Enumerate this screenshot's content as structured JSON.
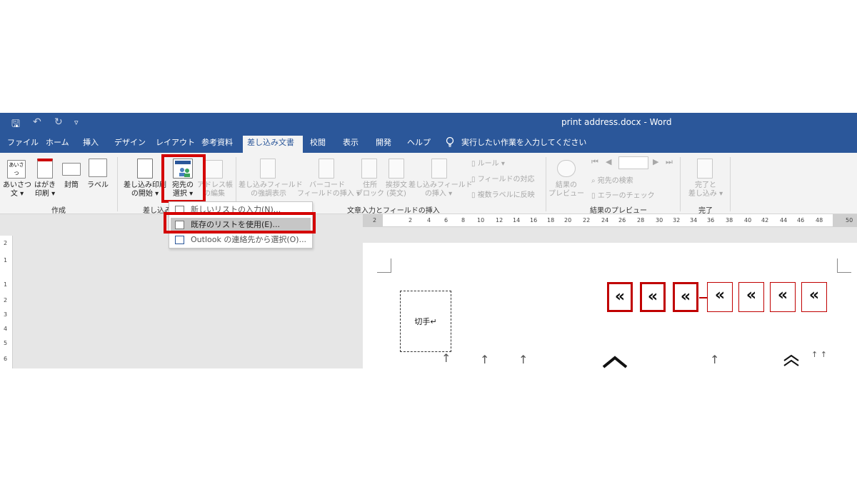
{
  "titlebar": {
    "title": "print address.docx  -  Word",
    "qa_save": "🖫",
    "qa_undo": "↶",
    "qa_redo": "↻",
    "qa_more": "▿"
  },
  "tabs": [
    {
      "label": "ファイル"
    },
    {
      "label": "ホーム"
    },
    {
      "label": "挿入"
    },
    {
      "label": "デザイン"
    },
    {
      "label": "レイアウト"
    },
    {
      "label": "参考資料"
    },
    {
      "label": "差し込み文書"
    },
    {
      "label": "校閲"
    },
    {
      "label": "表示"
    },
    {
      "label": "開発"
    },
    {
      "label": "ヘルプ"
    }
  ],
  "tellme": "実行したい作業を入力してください",
  "ribbon": {
    "create": {
      "group": "作成",
      "greeting": {
        "l1": "あいさつ",
        "l2": "文 ▾",
        "icon_text": "あいさつ"
      },
      "postcard": {
        "l1": "はがき",
        "l2": "印刷 ▾"
      },
      "envelope": {
        "l1": "封筒"
      },
      "label": {
        "l1": "ラベル"
      }
    },
    "start": {
      "group": "差し込み",
      "start_merge": {
        "l1": "差し込み印刷",
        "l2": "の開始 ▾"
      },
      "select_recipients": {
        "l1": "宛先の",
        "l2": "選択 ▾"
      },
      "edit_list": {
        "l1": "アドレス帳",
        "l2": "の編集"
      }
    },
    "fields": {
      "group": "文章入力とフィールドの挿入",
      "highlight": {
        "l1": "差し込みフィールド",
        "l2": "の強調表示"
      },
      "barcode": {
        "l1": "バーコード",
        "l2": "フィールドの挿入 ▾"
      },
      "address_block": {
        "l1": "住所",
        "l2": "ブロック"
      },
      "greeting_line": {
        "l1": "挨拶文",
        "l2": "(英文)"
      },
      "insert_field": {
        "l1": "差し込みフィールド",
        "l2": "の挿入 ▾"
      },
      "rules": "ルール ▾",
      "match_fields": "フィールドの対応",
      "update_labels": "複数ラベルに反映"
    },
    "preview": {
      "group": "結果のプレビュー",
      "preview_results": {
        "l1": "結果の",
        "l2": "プレビュー"
      },
      "find_recipient": "宛先の検索",
      "check_errors": "エラーのチェック"
    },
    "finish": {
      "group": "完了",
      "finish_merge": {
        "l1": "完了と",
        "l2": "差し込み ▾"
      }
    }
  },
  "dropdown": {
    "items": [
      {
        "label": "新しいリストの入力(N)..."
      },
      {
        "label": "既存のリストを使用(E)..."
      },
      {
        "label": "Outlook の連絡先から選択(O)..."
      }
    ]
  },
  "ruler": {
    "ticks": [
      "2",
      "2",
      "4",
      "6",
      "8",
      "10",
      "12",
      "14",
      "16",
      "18",
      "20",
      "22",
      "24",
      "26",
      "28",
      "30",
      "32",
      "34",
      "36",
      "38",
      "40",
      "42",
      "44",
      "46",
      "48",
      "50"
    ],
    "vticks": [
      "2",
      "1",
      "1",
      "2",
      "3",
      "4",
      "5",
      "6"
    ]
  },
  "document": {
    "stamp": "切手↵",
    "merge_marks": [
      "«",
      "«",
      "«",
      "«",
      "«",
      "«",
      "«"
    ]
  },
  "colors": {
    "ribbon_blue": "#2b579a",
    "highlight_red": "#d40000"
  }
}
